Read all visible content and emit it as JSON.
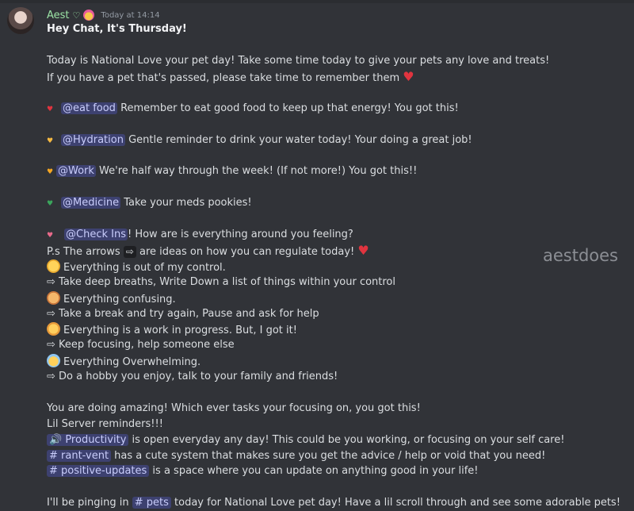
{
  "message": {
    "author": "Aest",
    "author_badge": "♡",
    "timestamp": "Today at 14:14",
    "title": "Hey Chat, It's Thursday!",
    "intro_1": "Today is National Love your pet day! Take some time today to give your pets any love and treats!",
    "intro_2": "If you have a pet that's passed, please take time to remember them",
    "reminders": [
      {
        "pin": "♥",
        "pin_color": "#e0343f",
        "mention": "@eat food",
        "text": "  Remember to eat good food to keep up that energy! You got this!"
      },
      {
        "pin": "♥",
        "pin_color": "#f5b942",
        "mention": "@Hydration",
        "text": "  Gentle reminder to drink your water today! Your doing a great job!"
      },
      {
        "pin": "♥",
        "pin_color": "#f5a623",
        "mention": "@Work",
        "text": "  We're half way through the week! (If not more!)  You got this!!"
      },
      {
        "pin": "♥",
        "pin_color": "#3ba55c",
        "mention": "@Medicine",
        "text": " Take your meds pookies!"
      },
      {
        "pin": "♥",
        "pin_color": "#e86a8a",
        "mention": "@Check Ins",
        "text": "!  How are is everything around you feeling?"
      }
    ],
    "ps_prefix": "P.s The arrows",
    "ps_arrow": "⇨",
    "ps_suffix": "are ideas on how you can regulate today!",
    "tips": [
      {
        "feeling": "Everything is out of my control.",
        "advice": "⇨ Take deep breaths, Write Down a list of things within your control"
      },
      {
        "feeling": "Everything confusing.",
        "advice": "⇨ Take a break and try again,  Pause and ask for help"
      },
      {
        "feeling": "Everything is a work in progress. But, I got it!",
        "advice": "⇨ Keep focusing, help someone else"
      },
      {
        "feeling": "Everything Overwhelming.",
        "advice": "⇨ Do a hobby you enjoy, talk to your family and friends!"
      }
    ],
    "outro_1": "You are doing amazing! Which ever tasks your focusing on, you got this!",
    "outro_2": "Lil Server reminders!!!",
    "server_reminders": [
      {
        "channel": "🔊 Productivity",
        "text": " is open everyday any day!  This could be you working, or focusing on your self care!"
      },
      {
        "channel": "# rant-vent",
        "text": " has a cute system that makes sure you get the advice / help or void that you need!"
      },
      {
        "channel": "# positive-updates",
        "text": "  is a space where you can update on anything good in your life!"
      }
    ],
    "pinging_prefix": "I'll be pinging in",
    "pinging_channel": "# pets",
    "pinging_suffix": " today for National Love pet day! Have a lil scroll through and see some adorable pets!"
  },
  "watermark": "aestdoes"
}
